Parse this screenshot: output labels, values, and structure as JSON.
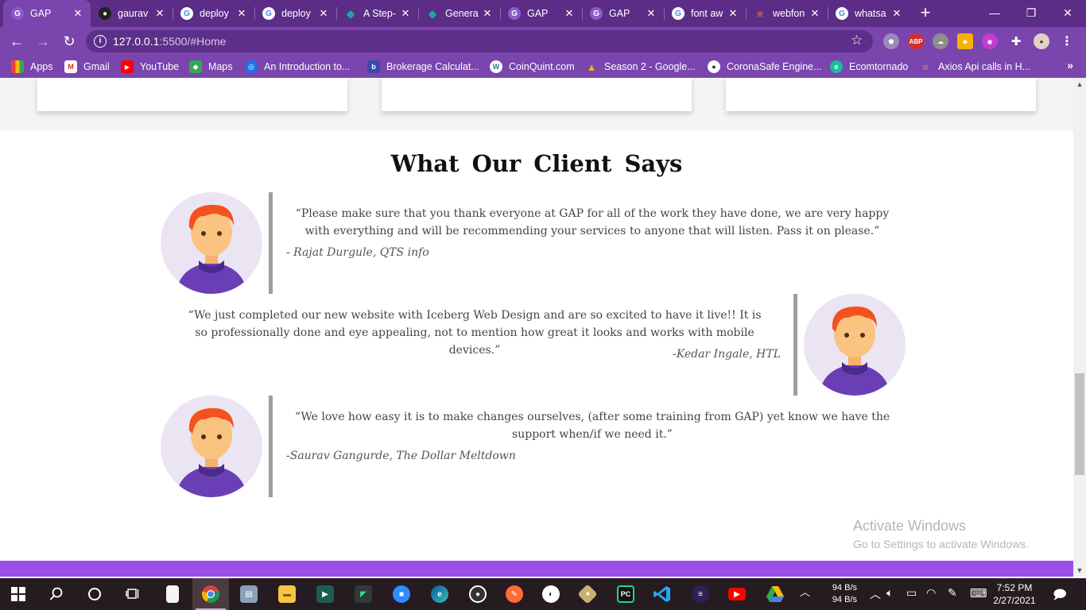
{
  "browser": {
    "tabs": [
      {
        "label": "GAP",
        "icon": "gap-favicon",
        "color": "#8a5cc9",
        "glyph": "G"
      },
      {
        "label": "gaurav",
        "icon": "github-favicon",
        "color": "#222222",
        "glyph": "●"
      },
      {
        "label": "deploy",
        "icon": "google-favicon",
        "color": "#ffffff",
        "glyph": "G"
      },
      {
        "label": "deploy",
        "icon": "google-favicon",
        "color": "#ffffff",
        "glyph": "G"
      },
      {
        "label": "A Step-",
        "icon": "diamond-favicon",
        "color": "#1aa9a0",
        "glyph": "◆"
      },
      {
        "label": "Genera",
        "icon": "diamond-favicon",
        "color": "#1aa9a0",
        "glyph": "◆"
      },
      {
        "label": "GAP",
        "icon": "gap-favicon",
        "color": "#8a5cc9",
        "glyph": "G"
      },
      {
        "label": "GAP",
        "icon": "gap-favicon",
        "color": "#8a5cc9",
        "glyph": "G"
      },
      {
        "label": "font aw",
        "icon": "google-favicon",
        "color": "#ffffff",
        "glyph": "G"
      },
      {
        "label": "webfon",
        "icon": "stackoverflow-favicon",
        "color": "#f48024",
        "glyph": "≡"
      },
      {
        "label": "whatsa",
        "icon": "google-favicon",
        "color": "#ffffff",
        "glyph": "G"
      }
    ],
    "url_host": "127.0.0.1",
    "url_rest": ":5500/#Home",
    "bookmarks": [
      {
        "label": "Apps",
        "icon": "apps-grid-icon",
        "color": "#e8a33d",
        "glyph": "⋮⋮"
      },
      {
        "label": "Gmail",
        "icon": "gmail-icon",
        "color": "#d93025",
        "glyph": "M"
      },
      {
        "label": "YouTube",
        "icon": "youtube-icon",
        "color": "#ff0000",
        "glyph": "▶"
      },
      {
        "label": "Maps",
        "icon": "maps-icon",
        "color": "#34a853",
        "glyph": "◆"
      },
      {
        "label": "An Introduction to...",
        "icon": "intro-bookmark-icon",
        "color": "#1a73e8",
        "glyph": "◎"
      },
      {
        "label": "Brokerage Calculat...",
        "icon": "brokerage-icon",
        "color": "#3949ab",
        "glyph": "b"
      },
      {
        "label": "CoinQuint.com",
        "icon": "wordpress-icon",
        "color": "#21759b",
        "glyph": "W"
      },
      {
        "label": "Season 2 - Google...",
        "icon": "google-drive-icon",
        "color": "#f4b400",
        "glyph": "▲"
      },
      {
        "label": "CoronaSafe Engine...",
        "icon": "coronasafe-icon",
        "color": "#333333",
        "glyph": "●"
      },
      {
        "label": "Ecomtornado",
        "icon": "ecomtornado-icon",
        "color": "#1abc9c",
        "glyph": "e"
      },
      {
        "label": "Axios Api calls in H...",
        "icon": "stackoverflow-icon",
        "color": "#f48024",
        "glyph": "≡"
      }
    ]
  },
  "page": {
    "section_title": "What  Our  Client  Says",
    "testimonials": [
      {
        "quote": "“Please make sure that you thank everyone at GAP for all of the work they have done, we are very happy with everything and will be recommending your services to anyone that will listen. Pass it on please.”",
        "author": "- Rajat Durgule, QTS info"
      },
      {
        "quote": "“We just completed our new website with Iceberg Web Design and are so excited to have it live!! It is so professionally done and eye appealing, not to mention how great it looks and works with mobile devices.”",
        "author": "-Kedar Ingale, HTL"
      },
      {
        "quote": "“We love how easy it is to make changes ourselves, (after some training from GAP) yet know we have the support when/if we need it.”",
        "author": "-Saurav Gangurde, The Dollar Meltdown"
      }
    ],
    "watermark_line1": "Activate Windows",
    "watermark_line2": "Go to Settings to activate Windows."
  },
  "taskbar": {
    "net_up": "94 B/s",
    "net_down": "94 B/s",
    "time": "7:52 PM",
    "date": "2/27/2021"
  },
  "colors": {
    "tab_strip": "#5b2d86",
    "toolbar": "#7a45ad",
    "footer_band": "#9b4ee8",
    "avatar_bg": "#ebe4f3",
    "hair": "#f4511e",
    "shirt": "#6a3fb5"
  }
}
